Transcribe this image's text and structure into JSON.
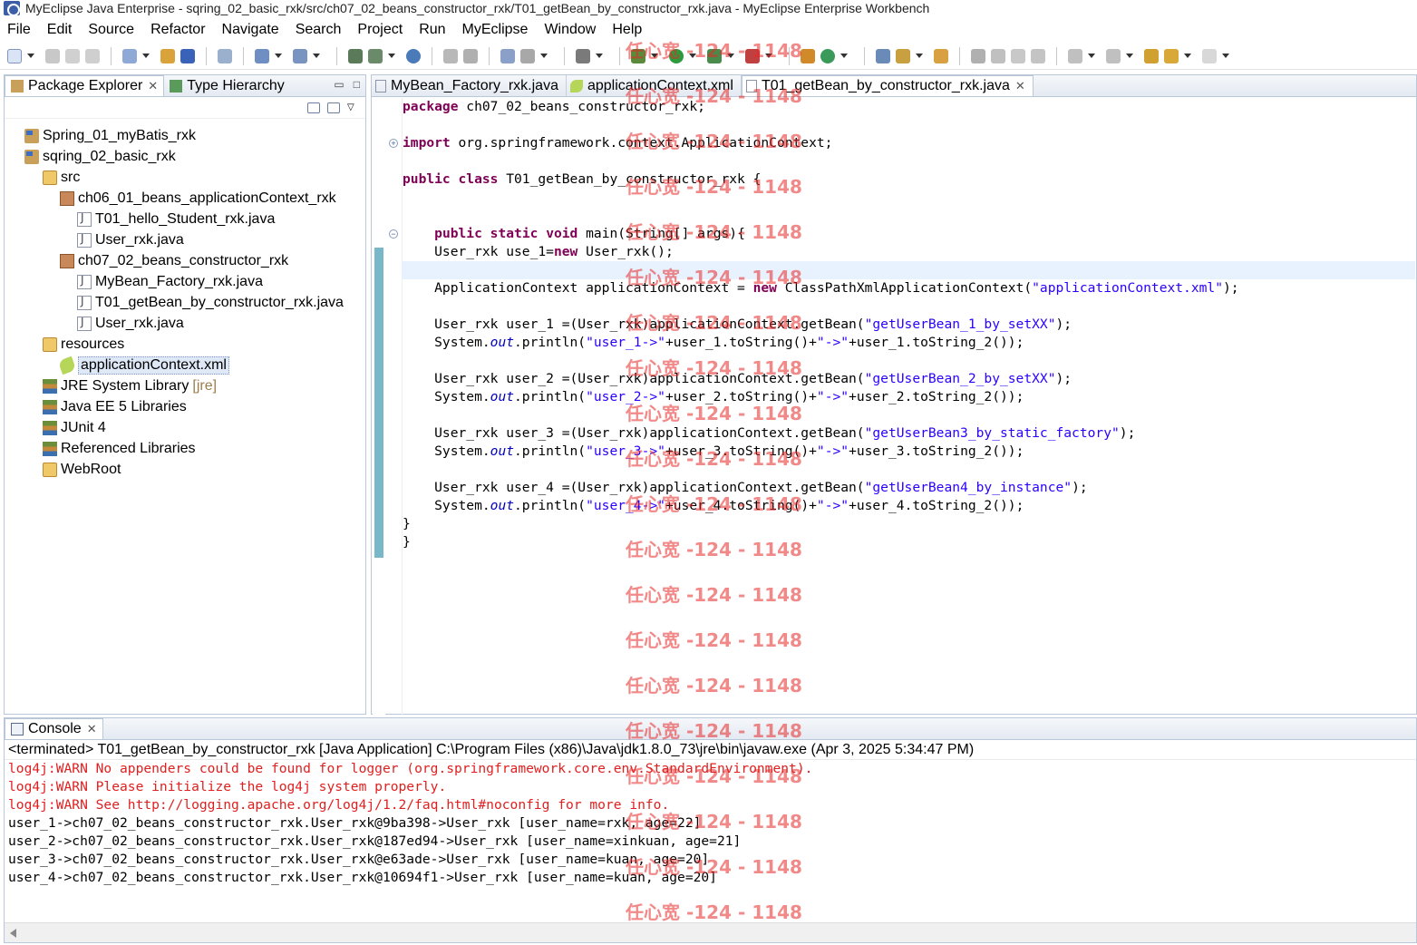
{
  "window": {
    "title": "MyEclipse Java Enterprise - sqring_02_basic_rxk/src/ch07_02_beans_constructor_rxk/T01_getBean_by_constructor_rxk.java - MyEclipse Enterprise Workbench"
  },
  "menu": [
    "File",
    "Edit",
    "Source",
    "Refactor",
    "Navigate",
    "Search",
    "Project",
    "Run",
    "MyEclipse",
    "Window",
    "Help"
  ],
  "left_panel": {
    "tabs": [
      {
        "label": "Package Explorer",
        "active": true
      },
      {
        "label": "Type Hierarchy",
        "active": false
      }
    ],
    "tree": [
      {
        "label": "Spring_01_myBatis_rxk",
        "icon": "project-icon",
        "level": 0
      },
      {
        "label": "sqring_02_basic_rxk",
        "icon": "project-icon",
        "level": 0
      },
      {
        "label": "src",
        "icon": "folder-icon",
        "level": 1
      },
      {
        "label": "ch06_01_beans_applicationContext_rxk",
        "icon": "package-icon",
        "level": 2
      },
      {
        "label": "T01_hello_Student_rxk.java",
        "icon": "java-file-icon",
        "level": 3
      },
      {
        "label": "User_rxk.java",
        "icon": "java-file-icon",
        "level": 3
      },
      {
        "label": "ch07_02_beans_constructor_rxk",
        "icon": "package-icon",
        "level": 2
      },
      {
        "label": "MyBean_Factory_rxk.java",
        "icon": "java-file-icon",
        "level": 3
      },
      {
        "label": "T01_getBean_by_constructor_rxk.java",
        "icon": "java-file-icon",
        "level": 3
      },
      {
        "label": "User_rxk.java",
        "icon": "java-file-icon",
        "level": 3
      },
      {
        "label": "resources",
        "icon": "folder-icon",
        "level": 1
      },
      {
        "label": "applicationContext.xml",
        "icon": "xml-file-icon",
        "level": 2,
        "selected": true
      },
      {
        "label": "JRE System Library",
        "icon": "library-icon",
        "level": 1,
        "tag": "[jre]"
      },
      {
        "label": "Java EE 5 Libraries",
        "icon": "library-icon",
        "level": 1
      },
      {
        "label": "JUnit 4",
        "icon": "library-icon",
        "level": 1
      },
      {
        "label": "Referenced Libraries",
        "icon": "library-icon",
        "level": 1
      },
      {
        "label": "WebRoot",
        "icon": "folder-icon",
        "level": 1
      }
    ]
  },
  "editor": {
    "tabs": [
      {
        "label": "MyBean_Factory_rxk.java",
        "active": false
      },
      {
        "label": "applicationContext.xml",
        "active": false
      },
      {
        "label": "T01_getBean_by_constructor_rxk.java",
        "active": true
      }
    ],
    "code": [
      [
        {
          "t": "package",
          "c": "kw"
        },
        {
          "t": " ch07_02_beans_constructor_rxk;"
        }
      ],
      [],
      [
        {
          "t": "import",
          "c": "kw"
        },
        {
          "t": " org.springframework.context.ApplicationContext;"
        }
      ],
      [],
      [
        {
          "t": "public",
          "c": "kw"
        },
        {
          "t": " "
        },
        {
          "t": "class",
          "c": "kw"
        },
        {
          "t": " T01_getBean_by_constructor_rxk {"
        }
      ],
      [],
      [],
      [
        {
          "t": "    "
        },
        {
          "t": "public",
          "c": "kw"
        },
        {
          "t": " "
        },
        {
          "t": "static",
          "c": "kw"
        },
        {
          "t": " "
        },
        {
          "t": "void",
          "c": "kw"
        },
        {
          "t": " main(String[] args){"
        }
      ],
      [
        {
          "t": "    User_rxk use_1="
        },
        {
          "t": "new",
          "c": "kw"
        },
        {
          "t": " User_rxk();"
        }
      ],
      [],
      [
        {
          "t": "    ApplicationContext applicationContext = "
        },
        {
          "t": "new",
          "c": "kw"
        },
        {
          "t": " ClassPathXmlApplicationContext("
        },
        {
          "t": "\"applicationContext.xml\"",
          "c": "str"
        },
        {
          "t": ");"
        }
      ],
      [],
      [
        {
          "t": "    User_rxk user_1 =(User_rxk)applicationContext.getBean("
        },
        {
          "t": "\"getUserBean_1_by_setXX\"",
          "c": "str"
        },
        {
          "t": ");"
        }
      ],
      [
        {
          "t": "    System."
        },
        {
          "t": "out",
          "c": "fld"
        },
        {
          "t": ".println("
        },
        {
          "t": "\"user_1->\"",
          "c": "str"
        },
        {
          "t": "+user_1.toString()+"
        },
        {
          "t": "\"->\"",
          "c": "str"
        },
        {
          "t": "+user_1.toString_2());"
        }
      ],
      [],
      [
        {
          "t": "    User_rxk user_2 =(User_rxk)applicationContext.getBean("
        },
        {
          "t": "\"getUserBean_2_by_setXX\"",
          "c": "str"
        },
        {
          "t": ");"
        }
      ],
      [
        {
          "t": "    System."
        },
        {
          "t": "out",
          "c": "fld"
        },
        {
          "t": ".println("
        },
        {
          "t": "\"user_2->\"",
          "c": "str"
        },
        {
          "t": "+user_2.toString()+"
        },
        {
          "t": "\"->\"",
          "c": "str"
        },
        {
          "t": "+user_2.toString_2());"
        }
      ],
      [],
      [
        {
          "t": "    User_rxk user_3 =(User_rxk)applicationContext.getBean("
        },
        {
          "t": "\"getUserBean3_by_static_factory\"",
          "c": "str"
        },
        {
          "t": ");"
        }
      ],
      [
        {
          "t": "    System."
        },
        {
          "t": "out",
          "c": "fld"
        },
        {
          "t": ".println("
        },
        {
          "t": "\"user_3->\"",
          "c": "str"
        },
        {
          "t": "+user_3.toString()+"
        },
        {
          "t": "\"->\"",
          "c": "str"
        },
        {
          "t": "+user_3.toString_2());"
        }
      ],
      [],
      [
        {
          "t": "    User_rxk user_4 =(User_rxk)applicationContext.getBean("
        },
        {
          "t": "\"getUserBean4_by_instance\"",
          "c": "str"
        },
        {
          "t": ");"
        }
      ],
      [
        {
          "t": "    System."
        },
        {
          "t": "out",
          "c": "fld"
        },
        {
          "t": ".println("
        },
        {
          "t": "\"user_4->\"",
          "c": "str"
        },
        {
          "t": "+user_4.toString()+"
        },
        {
          "t": "\"->\"",
          "c": "str"
        },
        {
          "t": "+user_4.toString_2());"
        }
      ],
      [
        {
          "t": "}"
        }
      ],
      [
        {
          "t": "}"
        }
      ]
    ]
  },
  "console": {
    "tab_label": "Console",
    "status": "<terminated> T01_getBean_by_constructor_rxk [Java Application] C:\\Program Files (x86)\\Java\\jdk1.8.0_73\\jre\\bin\\javaw.exe (Apr 3, 2025 5:34:47 PM)",
    "lines": [
      {
        "text": "log4j:WARN No appenders could be found for logger (org.springframework.core.env.StandardEnvironment).",
        "type": "err"
      },
      {
        "text": "log4j:WARN Please initialize the log4j system properly.",
        "type": "err"
      },
      {
        "text": "log4j:WARN See http://logging.apache.org/log4j/1.2/faq.html#noconfig for more info.",
        "type": "err"
      },
      {
        "text": "user_1->ch07_02_beans_constructor_rxk.User_rxk@9ba398->User_rxk [user_name=rxk, age=22]",
        "type": "out"
      },
      {
        "text": "user_2->ch07_02_beans_constructor_rxk.User_rxk@187ed94->User_rxk [user_name=xinkuan, age=21]",
        "type": "out"
      },
      {
        "text": "user_3->ch07_02_beans_constructor_rxk.User_rxk@e63ade->User_rxk [user_name=kuan, age=20]",
        "type": "out"
      },
      {
        "text": "user_4->ch07_02_beans_constructor_rxk.User_rxk@10694f1->User_rxk [user_name=kuan, age=20]",
        "type": "out"
      }
    ]
  },
  "watermark": {
    "text": "任心宽 -124 - 1148",
    "color": "#e62828"
  },
  "colors": {
    "keyword": "#7f0055",
    "string": "#2a00ff",
    "field": "#0000c0",
    "console_error": "#e02020",
    "selection": "#dfe8f6"
  }
}
